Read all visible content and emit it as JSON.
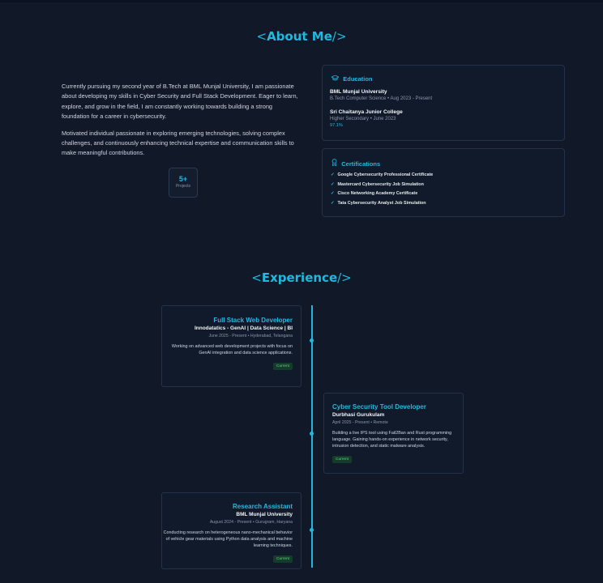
{
  "about": {
    "title_open": "<",
    "title": "About Me",
    "title_close": "/>",
    "paragraphs": [
      "Currently pursuing my second year of B.Tech at BML Munjal University, I am passionate about developing my skills in Cyber Security and Full Stack Development. Eager to learn, explore, and grow in the field, I am constantly working towards building a strong foundation for a career in cybersecurity.",
      "Motivated individual passionate in exploring emerging technologies, solving complex challenges, and continuously enhancing technical expertise and communication skills to make meaningful contributions."
    ],
    "stat": {
      "value": "5+",
      "label": "Projects"
    }
  },
  "education": {
    "heading": "Education",
    "icon": "graduation-cap-icon",
    "items": [
      {
        "name": "BML Munjal University",
        "detail": "B.Tech Computer Science • Aug 2023 - Present",
        "grade": ""
      },
      {
        "name": "Sri Chaitanya Junior College",
        "detail": "Higher Secondary • June 2023",
        "grade": "97.1%"
      }
    ]
  },
  "certifications": {
    "heading": "Certifications",
    "icon": "award-icon",
    "items": [
      "Google Cybersecurity Professional Certificate",
      "Mastercard Cybersecurity Job Simulation",
      "Cisco Networking Academy Certificate",
      "Tata Cybersecurity Analyst Job Simulation"
    ]
  },
  "experience": {
    "title_open": "<",
    "title": "Experience",
    "title_close": "/>",
    "items": [
      {
        "role": "Full Stack Web Developer",
        "org": "Innodatatics - GenAI | Data Science | BI",
        "meta": "June 2025 - Present • Hyderabad, Telangana",
        "desc": "Working on advanced web development projects with focus on GenAI integration and data science applications.",
        "badge": "Current"
      },
      {
        "role": "Cyber Security Tool Developer",
        "org": "Durbhasi Gurukulam",
        "meta": "April 2025 - Present • Remote",
        "desc": "Building a live IPS tool using Fail2Ban and Rust programming language. Gaining hands-on experience in network security, intrusion detection, and static malware analysis.",
        "badge": "Current"
      },
      {
        "role": "Research Assistant",
        "org": "BML Munjal University",
        "meta": "August 2024 - Present • Gurugram, Haryana",
        "desc": "Conducting research on heterogeneous nano-mechanical behavior of vehicle gear materials using Python data analysis and machine learning techniques.",
        "badge": "Current"
      }
    ]
  },
  "colors": {
    "accent": "#22b8dd",
    "background": "#111827",
    "card": "#111a2b",
    "badge": "#4ade80"
  }
}
